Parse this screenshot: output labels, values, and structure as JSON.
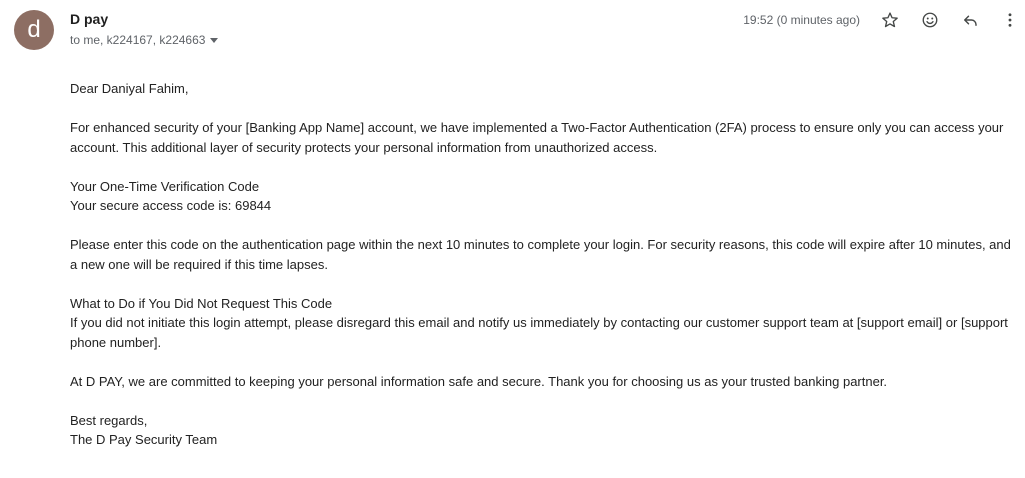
{
  "sender": {
    "avatar_letter": "d",
    "avatar_color": "#8d6e63",
    "name": "D pay",
    "recipients": "to me, k224167, k224663"
  },
  "meta": {
    "timestamp": "19:52 (0 minutes ago)"
  },
  "actions": {
    "icons": [
      "star-icon",
      "emoji-icon",
      "reply-icon",
      "more-vert-icon"
    ]
  },
  "email_body": {
    "greeting": "Dear Daniyal Fahim,",
    "intro": "For enhanced security of your [Banking App Name] account, we have implemented a Two-Factor Authentication (2FA) process to ensure only you can access your account. This additional layer of security protects your personal information from unauthorized access.",
    "code_heading": "Your One-Time Verification Code",
    "code_line": "Your secure access code is: 69844",
    "instructions": "Please enter this code on the authentication page within the next 10 minutes to complete your login. For security reasons, this code will expire after 10 minutes, and a new one will be required if this time lapses.",
    "not_request_heading": "What to Do if You Did Not Request This Code",
    "not_request_text": "If you did not initiate this login attempt, please disregard this email and notify us immediately by contacting our customer support team at [support email] or [support phone number].",
    "commitment": "At D PAY, we are committed to keeping your personal information safe and secure. Thank you for choosing us as your trusted banking partner.",
    "signoff": "Best regards,",
    "signature": "The D Pay Security Team"
  }
}
